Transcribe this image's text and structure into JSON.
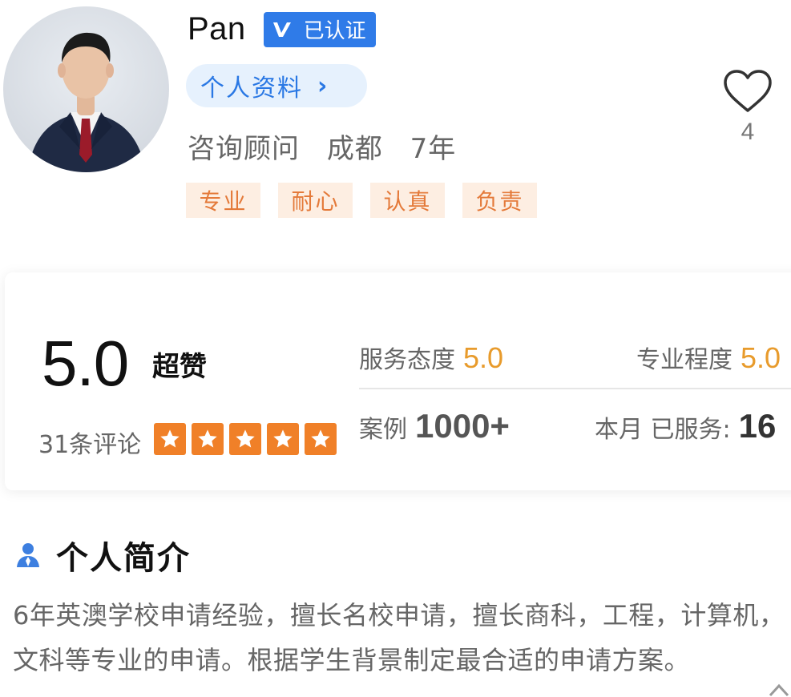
{
  "profile": {
    "name": "Pan",
    "verified_label": "已认证",
    "profile_link_label": "个人资料",
    "chevron": "›",
    "role": "咨询顾问",
    "city": "成都",
    "experience": "7年",
    "tags": [
      "专业",
      "耐心",
      "认真",
      "负责"
    ],
    "like_count": "4",
    "icons": {
      "avatar": "portrait-photo",
      "like": "heart-outline-icon",
      "verified": "check-v-icon"
    }
  },
  "rating": {
    "score": "5.0",
    "score_word": "超赞",
    "review_count": "31条评论",
    "stars": 5,
    "service_attitude_label": "服务态度",
    "service_attitude_value": "5.0",
    "professionalism_label": "专业程度",
    "professionalism_value": "5.0",
    "cases_label": "案例",
    "cases_value": "1000+",
    "month_served_label": "本月 已服务:",
    "month_served_value": "16"
  },
  "intro": {
    "title": "个人简介",
    "text": "6年英澳学校申请经验，擅长名校申请，擅长商科，工程，计算机，文科等专业的申请。根据学生背景制定最合适的申请方案。"
  },
  "colors": {
    "verified_bg": "#2f7be8",
    "link_bg": "#e6f1fd",
    "link_text": "#2a78e4",
    "tag_bg": "#fdeee2",
    "tag_text": "#e47a3a",
    "star_bg": "#f08028",
    "rating_value": "#e89b2c"
  }
}
